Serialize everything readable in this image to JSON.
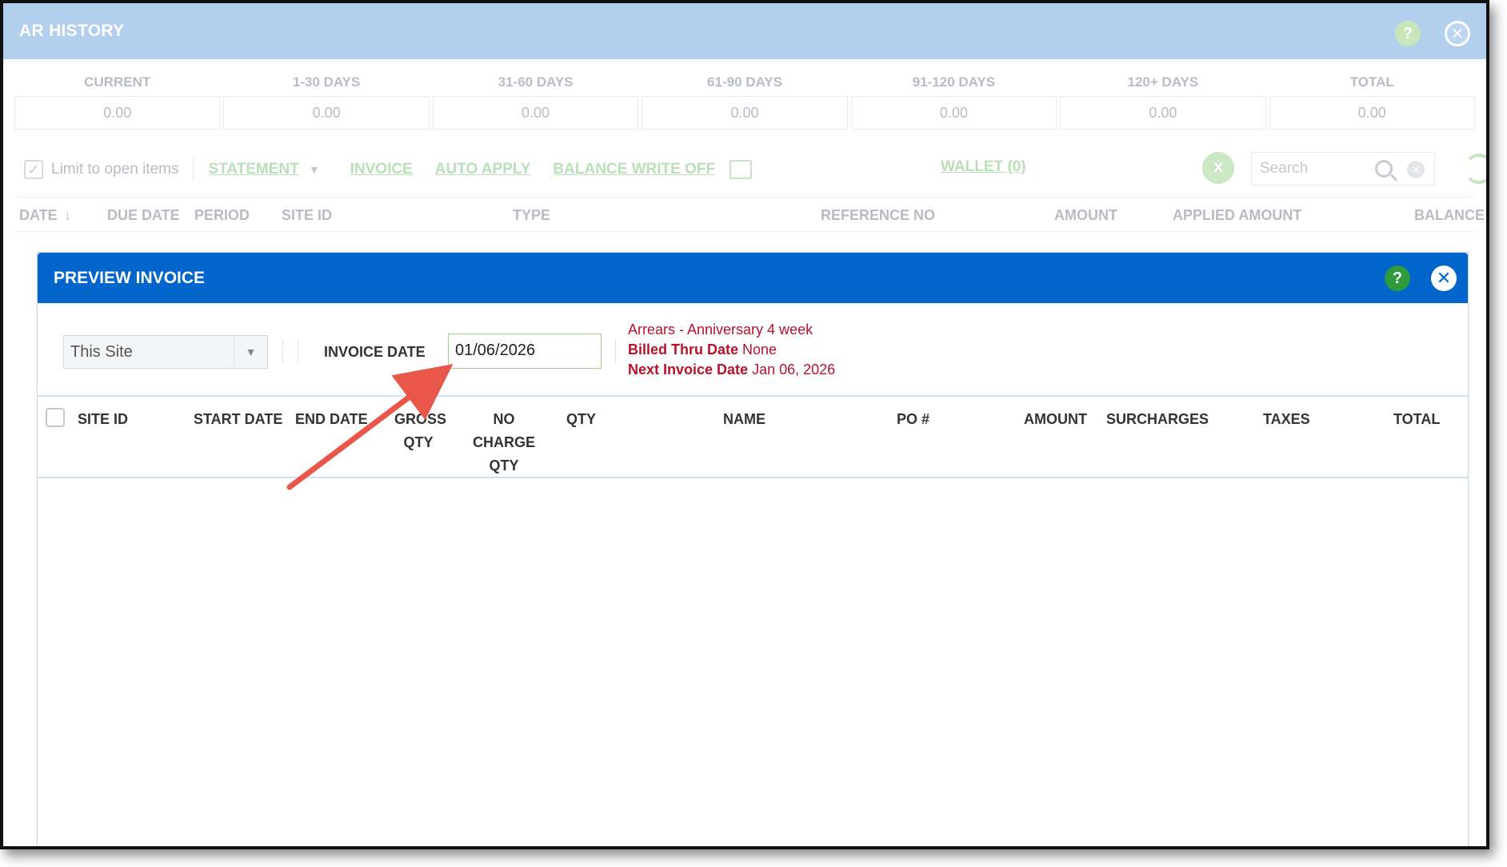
{
  "ar_history": {
    "title": "AR HISTORY",
    "aging": [
      {
        "label": "CURRENT",
        "value": "0.00"
      },
      {
        "label": "1-30 DAYS",
        "value": "0.00"
      },
      {
        "label": "31-60 DAYS",
        "value": "0.00"
      },
      {
        "label": "61-90 DAYS",
        "value": "0.00"
      },
      {
        "label": "91-120 DAYS",
        "value": "0.00"
      },
      {
        "label": "120+ DAYS",
        "value": "0.00"
      },
      {
        "label": "TOTAL",
        "value": "0.00"
      }
    ],
    "toolbar": {
      "limit_label": "Limit to open items",
      "statement": "STATEMENT",
      "invoice": "INVOICE",
      "auto_apply": "AUTO APPLY",
      "balance_write_off": "BALANCE WRITE OFF",
      "wallet": "WALLET (0)",
      "search_placeholder": "Search"
    },
    "columns": [
      "DATE",
      "DUE DATE",
      "PERIOD",
      "SITE ID",
      "TYPE",
      "REFERENCE NO",
      "AMOUNT",
      "APPLIED AMOUNT",
      "BALANCE"
    ]
  },
  "preview_invoice": {
    "title": "PREVIEW INVOICE",
    "site_select": "This Site",
    "invoice_date_label": "INVOICE DATE",
    "invoice_date_value": "01/06/2026",
    "info": {
      "line1": "Arrears - Anniversary 4 week",
      "billed_thru_label": "Billed Thru Date",
      "billed_thru_value": "None",
      "next_invoice_label": "Next Invoice Date",
      "next_invoice_value": "Jan 06, 2026"
    },
    "columns": {
      "site_id": "SITE ID",
      "start_date": "START DATE",
      "end_date": "END DATE",
      "gross_qty_1": "GROSS",
      "gross_qty_2": "QTY",
      "no_charge_1": "NO",
      "no_charge_2": "CHARGE",
      "no_charge_3": "QTY",
      "qty": "QTY",
      "name": "NAME",
      "po": "PO #",
      "amount": "AMOUNT",
      "surcharges": "SURCHARGES",
      "taxes": "TAXES",
      "total": "TOTAL"
    }
  },
  "icons": {
    "help": "?",
    "close": "✕",
    "excel": "X",
    "caret": "▼"
  },
  "colors": {
    "modal_header": "#0066cc",
    "ar_header": "#b3cfee",
    "info_red": "#b7122a",
    "annotation_arrow": "#e8574a"
  }
}
